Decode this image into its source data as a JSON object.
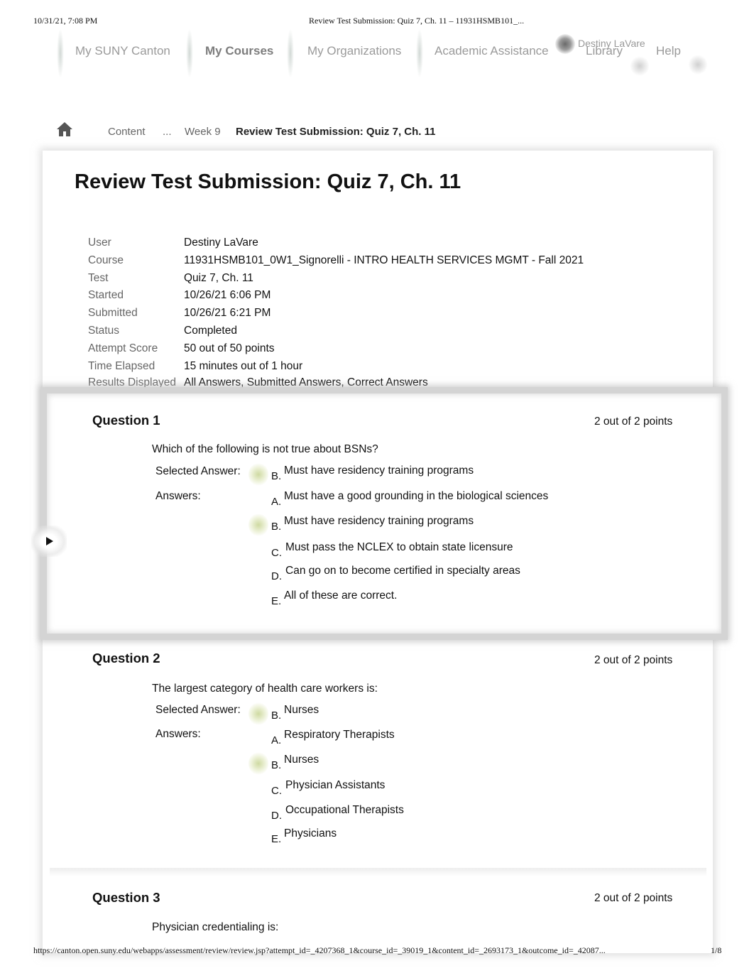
{
  "print_header": {
    "date": "10/31/21, 7:08 PM",
    "title": "Review Test Submission: Quiz 7, Ch. 11 – 11931HSMB101_..."
  },
  "print_footer": {
    "url": "https://canton.open.suny.edu/webapps/assessment/review/review.jsp?attempt_id=_4207368_1&course_id=_39019_1&content_id=_2693173_1&outcome_id=_42087...",
    "page": "1/8"
  },
  "topnav": {
    "items": [
      {
        "label": "My SUNY Canton"
      },
      {
        "label": "My Courses",
        "active": true
      },
      {
        "label": "My Organizations"
      },
      {
        "label": "Academic Assistance"
      },
      {
        "label": "Library"
      },
      {
        "label": "Help"
      }
    ],
    "user_name": "Destiny LaVare"
  },
  "breadcrumb": {
    "home_icon": "home-icon",
    "items": [
      "Content",
      "...",
      "Week 9"
    ],
    "current": "Review Test Submission: Quiz 7, Ch. 11"
  },
  "page_title": "Review Test Submission: Quiz 7, Ch. 11",
  "info": [
    {
      "label": "User",
      "value": "Destiny LaVare"
    },
    {
      "label": "Course",
      "value": "11931HSMB101_0W1_Signorelli - INTRO HEALTH SERVICES MGMT - Fall 2021"
    },
    {
      "label": "Test",
      "value": "Quiz 7, Ch. 11"
    },
    {
      "label": "Started",
      "value": "10/26/21 6:06 PM"
    },
    {
      "label": "Submitted",
      "value": "10/26/21 6:21 PM"
    },
    {
      "label": "Status",
      "value": "Completed"
    },
    {
      "label": "Attempt Score",
      "value": "50 out of 50 points"
    },
    {
      "label": "Time Elapsed",
      "value": "15 minutes out of 1 hour"
    },
    {
      "label": "Results Displayed",
      "value": "All Answers, Submitted Answers, Correct Answers"
    }
  ],
  "labels": {
    "selected_answer": "Selected Answer:",
    "answers": "Answers:"
  },
  "colors": {
    "correct_highlight": "#c3d18a"
  },
  "questions": [
    {
      "title": "Question 1",
      "points": "2 out of 2 points",
      "text": "Which of the following is not true about BSNs?",
      "selected": {
        "letter": "B.",
        "text": "Must have residency training programs",
        "correct": true
      },
      "answers": [
        {
          "letter": "A.",
          "text": "Must have a good grounding in the biological sciences",
          "correct": false
        },
        {
          "letter": "B.",
          "text": "Must have residency training programs",
          "correct": true
        },
        {
          "letter": "C.",
          "text": "Must pass the NCLEX to obtain state licensure",
          "correct": false
        },
        {
          "letter": "D.",
          "text": "Can go on to become certified in specialty areas",
          "correct": false
        },
        {
          "letter": "E.",
          "text": "All of these are correct.",
          "correct": false
        }
      ]
    },
    {
      "title": "Question 2",
      "points": "2 out of 2 points",
      "text": "The largest category of health care workers is:",
      "selected": {
        "letter": "B.",
        "text": "Nurses",
        "correct": true
      },
      "answers": [
        {
          "letter": "A.",
          "text": "Respiratory Therapists",
          "correct": false
        },
        {
          "letter": "B.",
          "text": "Nurses",
          "correct": true
        },
        {
          "letter": "C.",
          "text": "Physician Assistants",
          "correct": false
        },
        {
          "letter": "D.",
          "text": "Occupational Therapists",
          "correct": false
        },
        {
          "letter": "E.",
          "text": "Physicians",
          "correct": false
        }
      ]
    },
    {
      "title": "Question 3",
      "points": "2 out of 2 points",
      "text": "Physician credentialing is:"
    }
  ]
}
